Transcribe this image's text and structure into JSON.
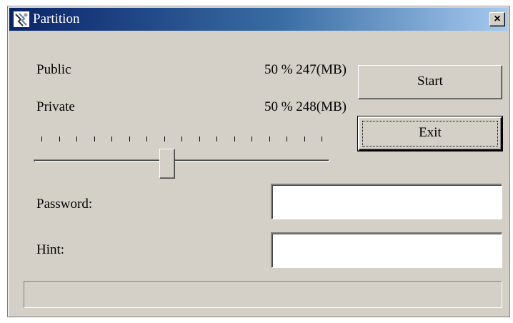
{
  "window": {
    "title": "Partition",
    "icon": "partition-app-icon",
    "close_label": "×"
  },
  "partition": {
    "public_label": "Public",
    "public_value": "50 % 247(MB)",
    "private_label": "Private",
    "private_value": "50 % 248(MB)",
    "slider": {
      "ticks": 17,
      "value_percent": 45
    }
  },
  "buttons": {
    "start_label": "Start",
    "exit_label": "Exit"
  },
  "form": {
    "password_label": "Password:",
    "password_value": "",
    "hint_label": "Hint:",
    "hint_value": ""
  },
  "status": {
    "progress_percent": 0
  },
  "colors": {
    "titlebar_start": "#0a246a",
    "titlebar_end": "#a6caf0",
    "face": "#d4d0c8"
  }
}
